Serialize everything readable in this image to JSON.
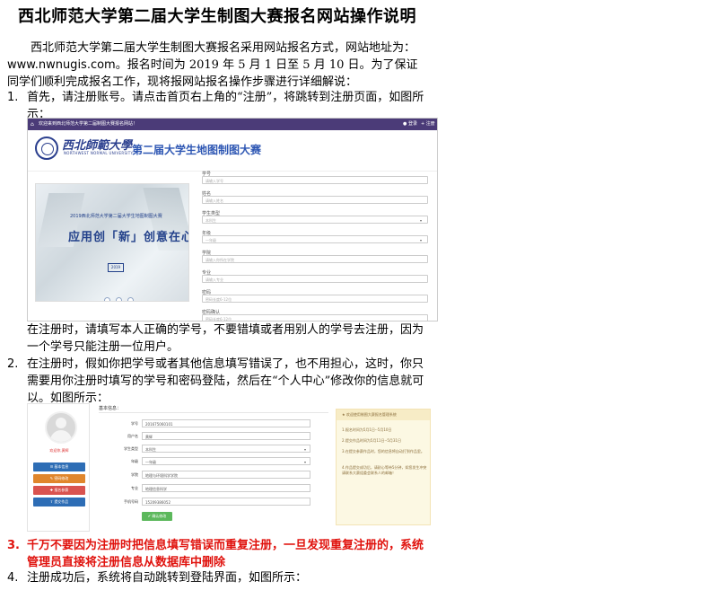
{
  "document": {
    "title": "西北师范大学第二届大学生制图大赛报名网站操作说明",
    "intro_1": "西北师范大学第二届大学生制图大赛报名采用网站报名方式，网站地址为：",
    "intro_url": "www.nwnugis.com",
    "intro_2": "。报名时间为 2019 年 5 月 1 日至 5 月 10 日。为了保证同学们顺利完成报名工作，现将报网站报名操作步骤进行详细解说：",
    "steps": [
      {
        "num": "1.",
        "text": "首先，请注册账号。请点击首页右上角的“注册”，将跳转到注册页面，如图所示："
      },
      {
        "num": "",
        "text": "在注册时，请填写本人正确的学号，不要错填或者用别人的学号去注册，因为一个学号只能注册一位用户。"
      },
      {
        "num": "2.",
        "text": "在注册时，假如你把学号或者其他信息填写错误了，也不用担心，这时，你只需要用你注册时填写的学号和密码登陆，然后在“个人中心”修改你的信息就可以。如图所示："
      },
      {
        "num": "3.",
        "text": "千万不要因为注册时把信息填写错误而重复注册，一旦发现重复注册的，系统管理员直接将注册信息从数据库中删除"
      },
      {
        "num": "4.",
        "text": "注册成功后，系统将自动跳转到登陆界面，如图所示："
      }
    ]
  },
  "register_screenshot": {
    "topbar_notice": "欢迎来到西北师范大学第二届制图大赛报名网站！",
    "login": "登录",
    "register": "注册",
    "logo_cn": "西北師範大學",
    "logo_en": "NORTHWEST NORMAL UNIVERSITY",
    "contest_title": "第二届大学生地图制图大赛",
    "slide_title": "2019西北师范大学第二届大学生地图制图大赛",
    "slide_slogan": "应用创「新」创意在心",
    "slide_badge": "2019",
    "fields": [
      {
        "label": "学号",
        "placeholder": "请输入学号",
        "select": false
      },
      {
        "label": "姓名",
        "placeholder": "请输入姓名",
        "select": false
      },
      {
        "label": "学生类型",
        "placeholder": "本科生",
        "select": true
      },
      {
        "label": "年级",
        "placeholder": "一年级",
        "select": true
      },
      {
        "label": "学院",
        "placeholder": "请输入你所在学院",
        "select": false
      },
      {
        "label": "专业",
        "placeholder": "请输入专业",
        "select": false
      },
      {
        "label": "密码",
        "placeholder": "密码长度6-12位",
        "select": false
      },
      {
        "label": "密码确认",
        "placeholder": "密码长度6-12位",
        "select": false
      }
    ]
  },
  "profile_screenshot": {
    "welcome": "欢迎你,黄辉",
    "menu": [
      {
        "label": "基本信息",
        "color": "#2d6db5"
      },
      {
        "label": "密码修改",
        "color": "#e0862c"
      },
      {
        "label": "报名参赛",
        "color": "#d9534f"
      },
      {
        "label": "提交作品",
        "color": "#2d6db5"
      }
    ],
    "section_title": "基本信息：",
    "rows": [
      {
        "label": "学号",
        "value": "201675060101",
        "select": false
      },
      {
        "label": "用户名",
        "value": "黄辉",
        "select": false
      },
      {
        "label": "学生类型",
        "value": "本科生",
        "select": true
      },
      {
        "label": "年级",
        "value": "一年级",
        "select": true
      },
      {
        "label": "学院",
        "value": "地理与环境科学学院",
        "select": false
      },
      {
        "label": "专业",
        "value": "地理信息科学",
        "select": false
      },
      {
        "label": "手机号码",
        "value": "15209386052",
        "select": false
      }
    ],
    "confirm": "确认修改",
    "notice_title": "欢迎使用制图大赛报名管理系统",
    "notice_lines": [
      "1.报名时间为5月1日--5月10日",
      "2.提交作品时间为5月11日--5月31日",
      "3.在提交参赛作品时，您的信息将自动打到作品里。",
      "4.作品提交成功后，请耐心等待5分钟，如您发生冲突请联系大赛组委会联系人的邮箱！"
    ]
  }
}
